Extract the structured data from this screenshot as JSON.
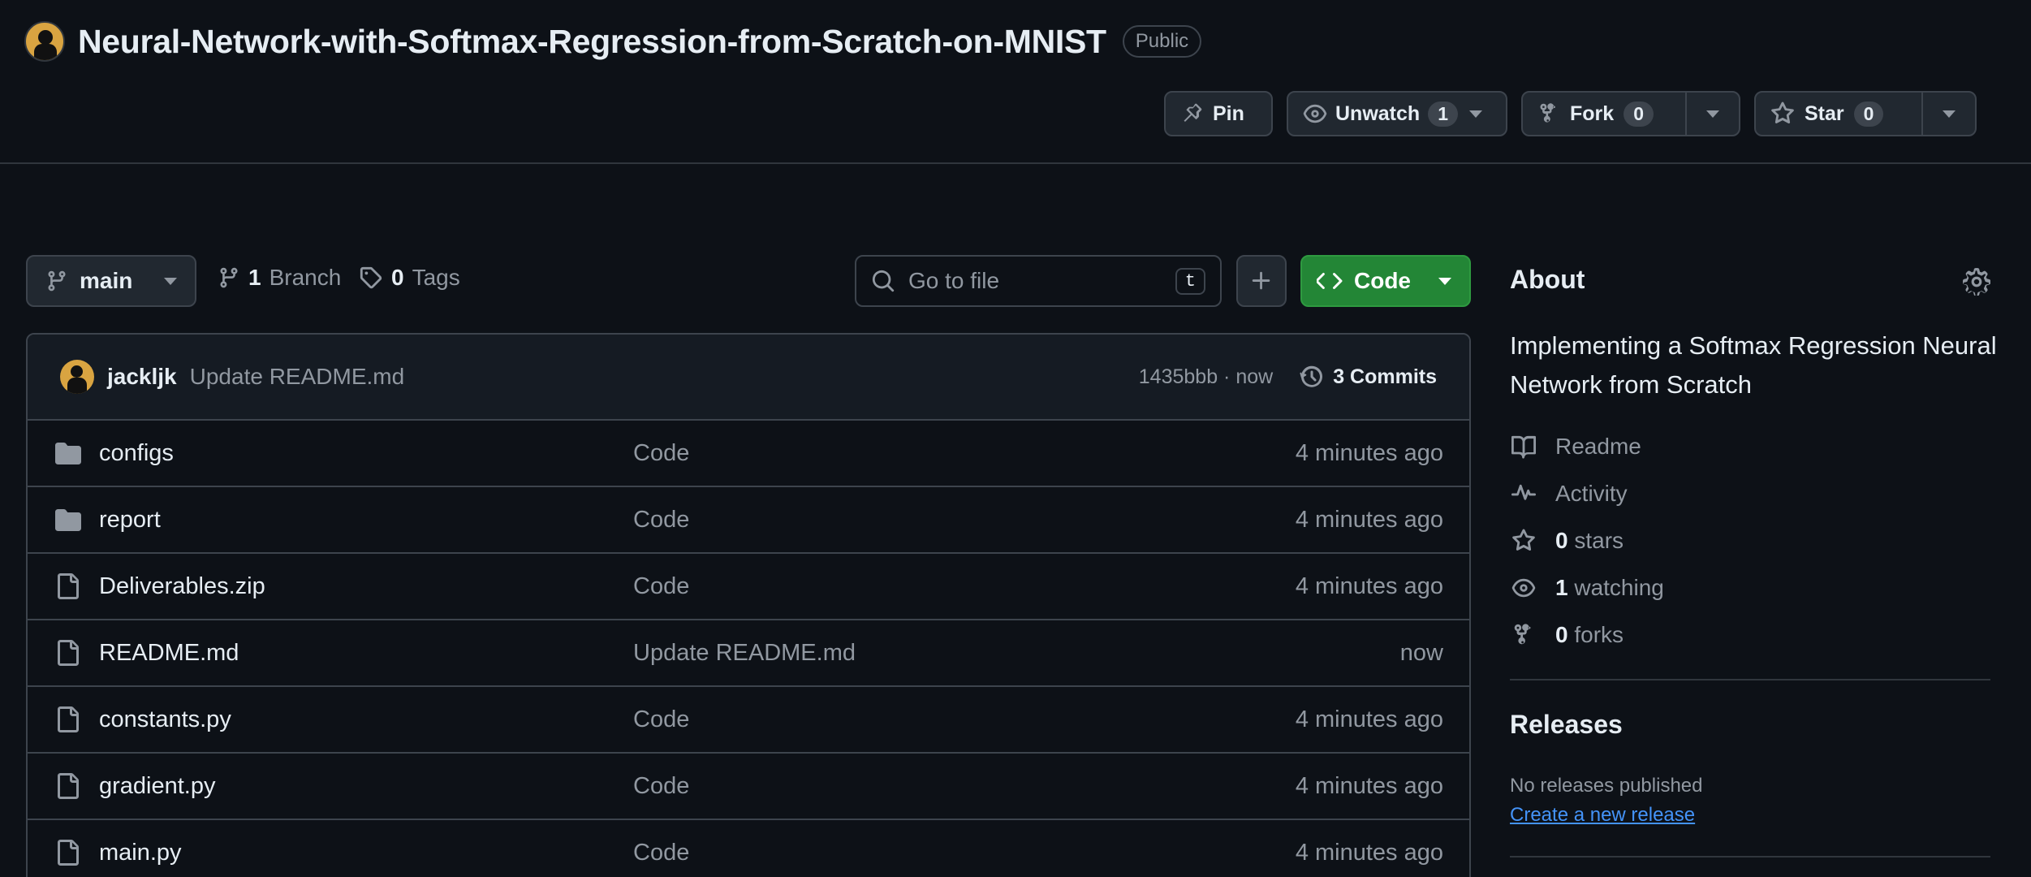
{
  "repo": {
    "name": "Neural-Network-with-Softmax-Regression-from-Scratch-on-MNIST",
    "visibility": "Public"
  },
  "actions": {
    "pin_label": "Pin",
    "unwatch_label": "Unwatch",
    "watch_count": "1",
    "fork_label": "Fork",
    "fork_count": "0",
    "star_label": "Star",
    "star_count": "0"
  },
  "toolbar": {
    "branch": "main",
    "branch_count": "1",
    "branch_label": "Branch",
    "tag_count": "0",
    "tag_label": "Tags",
    "search_placeholder": "Go to file",
    "search_shortcut": "t",
    "code_label": "Code"
  },
  "latest_commit": {
    "author": "jackljk",
    "message": "Update README.md",
    "meta": "1435bbb · now",
    "commits_label": "3 Commits"
  },
  "files": [
    {
      "name": "configs",
      "type": "folder",
      "message": "Code",
      "time": "4 minutes ago"
    },
    {
      "name": "report",
      "type": "folder",
      "message": "Code",
      "time": "4 minutes ago"
    },
    {
      "name": "Deliverables.zip",
      "type": "file",
      "message": "Code",
      "time": "4 minutes ago"
    },
    {
      "name": "README.md",
      "type": "file",
      "message": "Update README.md",
      "time": "now"
    },
    {
      "name": "constants.py",
      "type": "file",
      "message": "Code",
      "time": "4 minutes ago"
    },
    {
      "name": "gradient.py",
      "type": "file",
      "message": "Code",
      "time": "4 minutes ago"
    },
    {
      "name": "main.py",
      "type": "file",
      "message": "Code",
      "time": "4 minutes ago"
    }
  ],
  "about": {
    "title": "About",
    "description": "Implementing a Softmax Regression Neural Network from Scratch",
    "readme": "Readme",
    "activity": "Activity",
    "stars_count": "0",
    "stars_label": "stars",
    "watching_count": "1",
    "watching_label": "watching",
    "forks_count": "0",
    "forks_label": "forks"
  },
  "releases": {
    "title": "Releases",
    "empty": "No releases published",
    "create_link": "Create a new release"
  },
  "colors": {
    "background": "#0d1117",
    "border": "#3d444d",
    "muted_text": "#9198a1",
    "code_button": "#238636",
    "link": "#4493f8"
  }
}
